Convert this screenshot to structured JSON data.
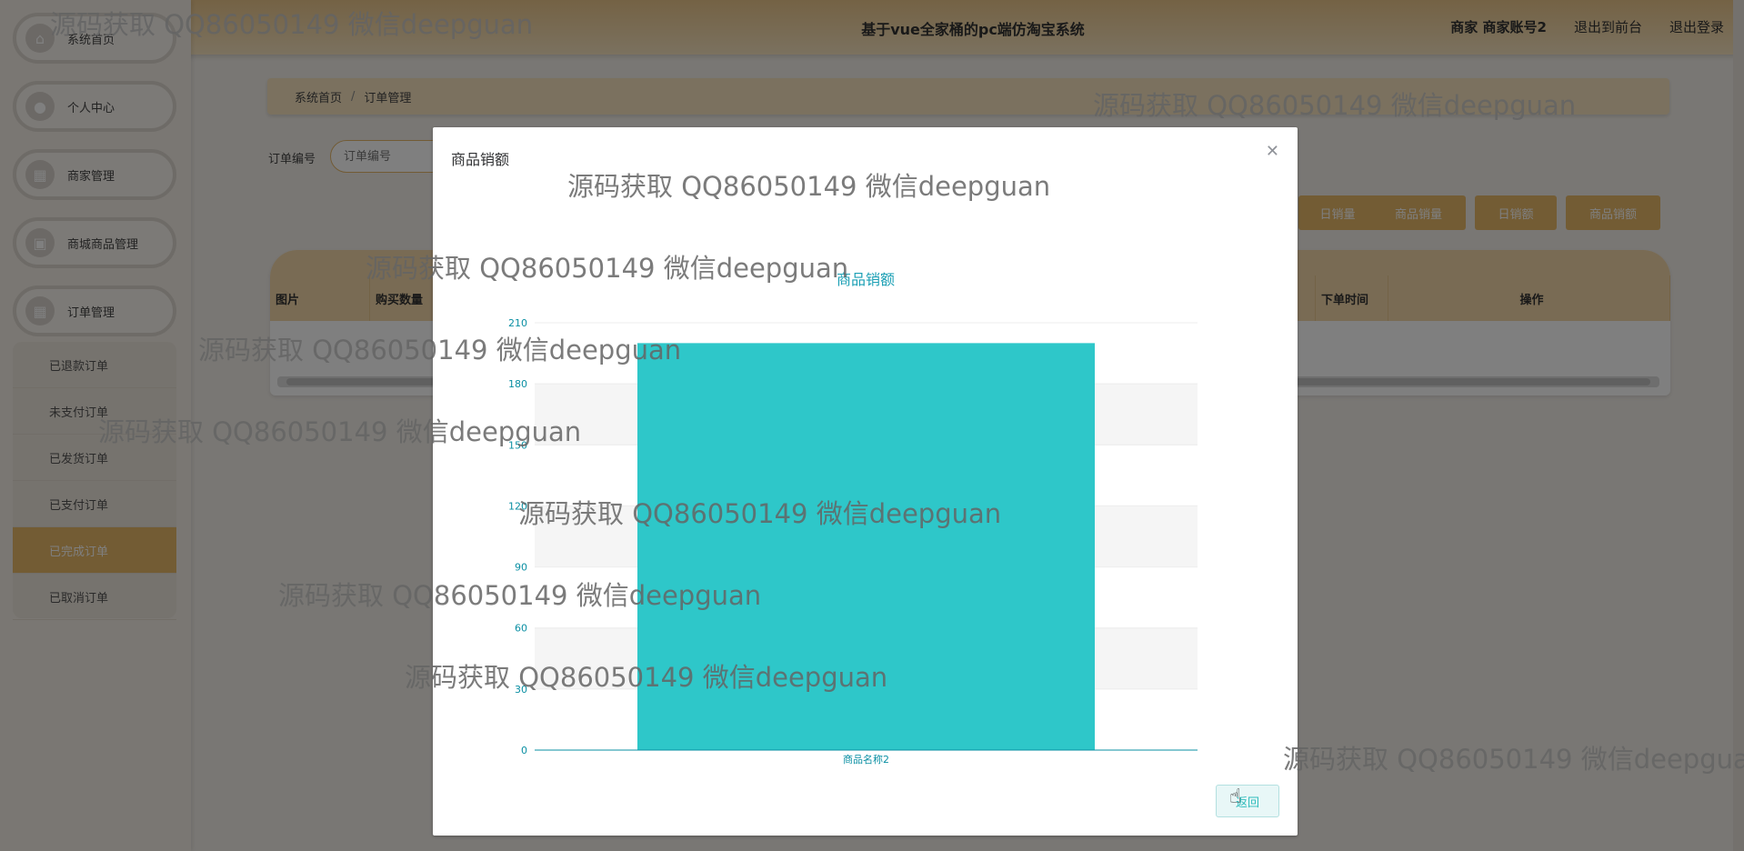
{
  "app": {
    "title": "基于vue全家桶的pc端仿淘宝系统"
  },
  "header": {
    "user": "商家 商家账号2",
    "to_front": "退出到前台",
    "logout": "退出登录"
  },
  "sidebar": {
    "items": [
      {
        "label": "系统首页",
        "icon": "home-icon"
      },
      {
        "label": "个人中心",
        "icon": "user-icon"
      },
      {
        "label": "商家管理",
        "icon": "grid-icon"
      },
      {
        "label": "商城商品管理",
        "icon": "bag-icon"
      },
      {
        "label": "订单管理",
        "icon": "grid-icon"
      }
    ],
    "sub_items": [
      "已退款订单",
      "未支付订单",
      "已发货订单",
      "已支付订单",
      "已完成订单",
      "已取消订单"
    ],
    "active_sub": "已完成订单"
  },
  "breadcrumb": {
    "home": "系统首页",
    "current": "订单管理"
  },
  "search": {
    "label": "订单编号",
    "placeholder": "订单编号"
  },
  "stat_buttons": [
    "日销量",
    "商品销量",
    "日销额",
    "商品销额"
  ],
  "table": {
    "headers": [
      "图片",
      "购买数量",
      "下单时间",
      "操作"
    ]
  },
  "modal": {
    "title": "商品销额",
    "back_label": "返回",
    "close_icon": "close-icon"
  },
  "watermark": "源码获取 QQ86050149 微信deepguan",
  "colors": {
    "accent": "#e7b869",
    "bar": "#2ec7c9",
    "axis": "#0a8fa3"
  },
  "chart_data": {
    "type": "bar",
    "title": "商品销额",
    "categories": [
      "商品名称2"
    ],
    "values": [
      200
    ],
    "ylim": [
      0,
      210
    ],
    "yticks": [
      0,
      30,
      60,
      90,
      120,
      150,
      180,
      210
    ],
    "xlabel": "",
    "ylabel": "",
    "grid": true
  }
}
